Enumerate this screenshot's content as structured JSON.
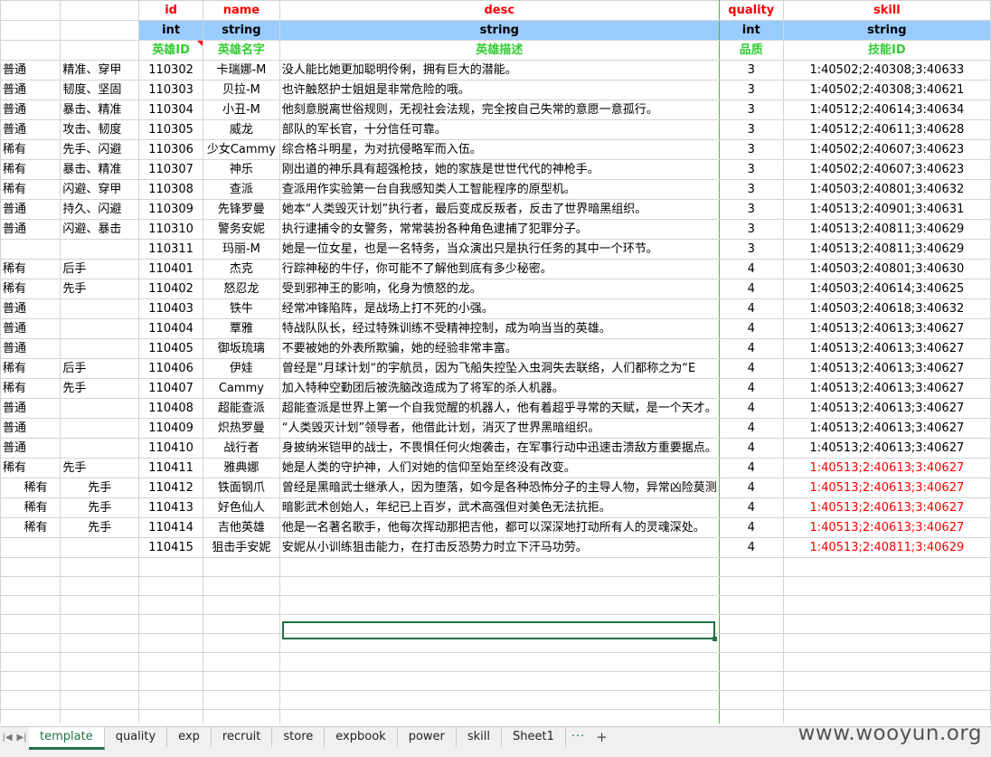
{
  "columns": [
    {
      "name": "id",
      "type": "int",
      "desc": "英雄ID"
    },
    {
      "name": "name",
      "type": "string",
      "desc": "英雄名字"
    },
    {
      "name": "desc",
      "type": "string",
      "desc": "英雄描述"
    },
    {
      "name": "quality",
      "type": "int",
      "desc": "品质"
    },
    {
      "name": "skill",
      "type": "string",
      "desc": "技能ID"
    }
  ],
  "rows": [
    {
      "a": "普通",
      "b": "精准、穿甲",
      "id": "110302",
      "name": "卡瑞娜-M",
      "desc": "没人能比她更加聪明伶俐，拥有巨大的潜能。",
      "quality": "3",
      "skill": "1:40502;2:40308;3:40633",
      "red": false
    },
    {
      "a": "普通",
      "b": "韧度、坚固",
      "id": "110303",
      "name": "贝拉-M",
      "desc": "也许触怒护士姐姐是非常危险的哦。",
      "quality": "3",
      "skill": "1:40502;2:40308;3:40621",
      "red": false
    },
    {
      "a": "普通",
      "b": "暴击、精准",
      "id": "110304",
      "name": "小丑-M",
      "desc": "他刻意脱离世俗规则，无视社会法规，完全按自己失常的意愿一意孤行。",
      "quality": "3",
      "skill": "1:40512;2:40614;3:40634",
      "red": false
    },
    {
      "a": "普通",
      "b": "攻击、韧度",
      "id": "110305",
      "name": "威龙",
      "desc": "部队的军长官，十分信任可靠。",
      "quality": "3",
      "skill": "1:40512;2:40611;3:40628",
      "red": false
    },
    {
      "a": "稀有",
      "b": "先手、闪避",
      "id": "110306",
      "name": "少女Cammy",
      "desc": "综合格斗明星，为对抗侵略军而入伍。",
      "quality": "3",
      "skill": "1:40502;2:40607;3:40623",
      "red": false
    },
    {
      "a": "稀有",
      "b": "暴击、精准",
      "id": "110307",
      "name": "神乐",
      "desc": "刚出道的神乐具有超强枪技，她的家族是世世代代的神枪手。",
      "quality": "3",
      "skill": "1:40502;2:40607;3:40623",
      "red": false
    },
    {
      "a": "稀有",
      "b": "闪避、穿甲",
      "id": "110308",
      "name": "查派",
      "desc": "查派用作实验第一台自我感知类人工智能程序的原型机。",
      "quality": "3",
      "skill": "1:40503;2:40801;3:40632",
      "red": false
    },
    {
      "a": "普通",
      "b": "持久、闪避",
      "id": "110309",
      "name": "先锋罗曼",
      "desc": "她本“人类毁灭计划”执行者，最后变成反叛者，反击了世界暗黑组织。",
      "quality": "3",
      "skill": "1:40513;2:40901;3:40631",
      "red": false
    },
    {
      "a": "普通",
      "b": "闪避、暴击",
      "id": "110310",
      "name": "警务安妮",
      "desc": "执行逮捕令的女警务，常常装扮各种角色逮捕了犯罪分子。",
      "quality": "3",
      "skill": "1:40513;2:40811;3:40629",
      "red": false
    },
    {
      "a": "",
      "b": "",
      "id": "110311",
      "name": "玛丽-M",
      "desc": "她是一位女星，也是一名特务，当众演出只是执行任务的其中一个环节。",
      "quality": "3",
      "skill": "1:40513;2:40811;3:40629",
      "red": false
    },
    {
      "a": "稀有",
      "b": "后手",
      "id": "110401",
      "name": "杰克",
      "desc": "行踪神秘的牛仔，你可能不了解他到底有多少秘密。",
      "quality": "4",
      "skill": "1:40503;2:40801;3:40630",
      "red": false
    },
    {
      "a": "稀有",
      "b": "先手",
      "id": "110402",
      "name": "怒忍龙",
      "desc": "受到邪神王的影响，化身为愤怒的龙。",
      "quality": "4",
      "skill": "1:40503;2:40614;3:40625",
      "red": false
    },
    {
      "a": "普通",
      "b": "",
      "id": "110403",
      "name": "铁牛",
      "desc": "经常冲锋陷阵，是战场上打不死的小强。",
      "quality": "4",
      "skill": "1:40503;2:40618;3:40632",
      "red": false
    },
    {
      "a": "普通",
      "b": "",
      "id": "110404",
      "name": "覃雅",
      "desc": "特战队队长，经过特殊训练不受精神控制，成为响当当的英雄。",
      "quality": "4",
      "skill": "1:40513;2:40613;3:40627",
      "red": false
    },
    {
      "a": "普通",
      "b": "",
      "id": "110405",
      "name": "御坂琉璃",
      "desc": "不要被她的外表所欺骗，她的经验非常丰富。",
      "quality": "4",
      "skill": "1:40513;2:40613;3:40627",
      "red": false
    },
    {
      "a": "稀有",
      "b": "后手",
      "id": "110406",
      "name": "伊娃",
      "desc": "曾经是”月球计划“的宇航员，因为飞船失控坠入虫洞失去联络，人们都称之为“E",
      "quality": "4",
      "skill": "1:40513;2:40613;3:40627",
      "red": false
    },
    {
      "a": "稀有",
      "b": "先手",
      "id": "110407",
      "name": "Cammy",
      "desc": "加入特种空勤团后被洗脑改造成为了将军的杀人机器。",
      "quality": "4",
      "skill": "1:40513;2:40613;3:40627",
      "red": false
    },
    {
      "a": "普通",
      "b": "",
      "id": "110408",
      "name": "超能查派",
      "desc": "超能查派是世界上第一个自我觉醒的机器人，他有着超乎寻常的天赋，是一个天才。",
      "quality": "4",
      "skill": "1:40513;2:40613;3:40627",
      "red": false
    },
    {
      "a": "普通",
      "b": "",
      "id": "110409",
      "name": "炽热罗曼",
      "desc": "“人类毁灭计划”领导者，他借此计划，消灭了世界黑暗组织。",
      "quality": "4",
      "skill": "1:40513;2:40613;3:40627",
      "red": false
    },
    {
      "a": "普通",
      "b": "",
      "id": "110410",
      "name": "战行者",
      "desc": "身披纳米铠甲的战士，不畏惧任何火炮袭击，在军事行动中迅速击溃敌方重要据点。",
      "quality": "4",
      "skill": "1:40513;2:40613;3:40627",
      "red": false
    },
    {
      "a": "稀有",
      "b": "先手",
      "id": "110411",
      "name": "雅典娜",
      "desc": "她是人类的守护神，人们对她的信仰至始至终没有改变。",
      "quality": "4",
      "skill": "1:40513;2:40613;3:40627",
      "red": true
    },
    {
      "a": "稀有",
      "b": "先手",
      "id": "110412",
      "name": "铁面钢爪",
      "desc": "曾经是黑暗武士继承人，因为堕落，如今是各种恐怖分子的主导人物，异常凶险莫测",
      "quality": "4",
      "skill": "1:40513;2:40613;3:40627",
      "red": true,
      "indent": true
    },
    {
      "a": "稀有",
      "b": "先手",
      "id": "110413",
      "name": "好色仙人",
      "desc": "暗影武术创始人，年纪已上百岁，武术高强但对美色无法抗拒。",
      "quality": "4",
      "skill": "1:40513;2:40613;3:40627",
      "red": true,
      "indent": true
    },
    {
      "a": "稀有",
      "b": "先手",
      "id": "110414",
      "name": "吉他英雄",
      "desc": "他是一名著名歌手，他每次挥动那把吉他，都可以深深地打动所有人的灵魂深处。",
      "quality": "4",
      "skill": "1:40513;2:40613;3:40627",
      "red": true,
      "indent": true
    },
    {
      "a": "",
      "b": "",
      "id": "110415",
      "name": "狙击手安妮",
      "desc": "安妮从小训练狙击能力，在打击反恐势力时立下汗马功劳。",
      "quality": "4",
      "skill": "1:40513;2:40811;3:40629",
      "red": true
    }
  ],
  "empty_rows": 9,
  "tabs": [
    "template",
    "quality",
    "exp",
    "recruit",
    "store",
    "expbook",
    "power",
    "skill",
    "Sheet1"
  ],
  "active_tab": "template",
  "tab_more": "···",
  "tab_add": "+",
  "watermark": "www.wooyun.org",
  "colors": {
    "header_name": "#ff0000",
    "type_bg": "#99ccff",
    "desc_green": "#33cc33",
    "selection": "#217346"
  }
}
